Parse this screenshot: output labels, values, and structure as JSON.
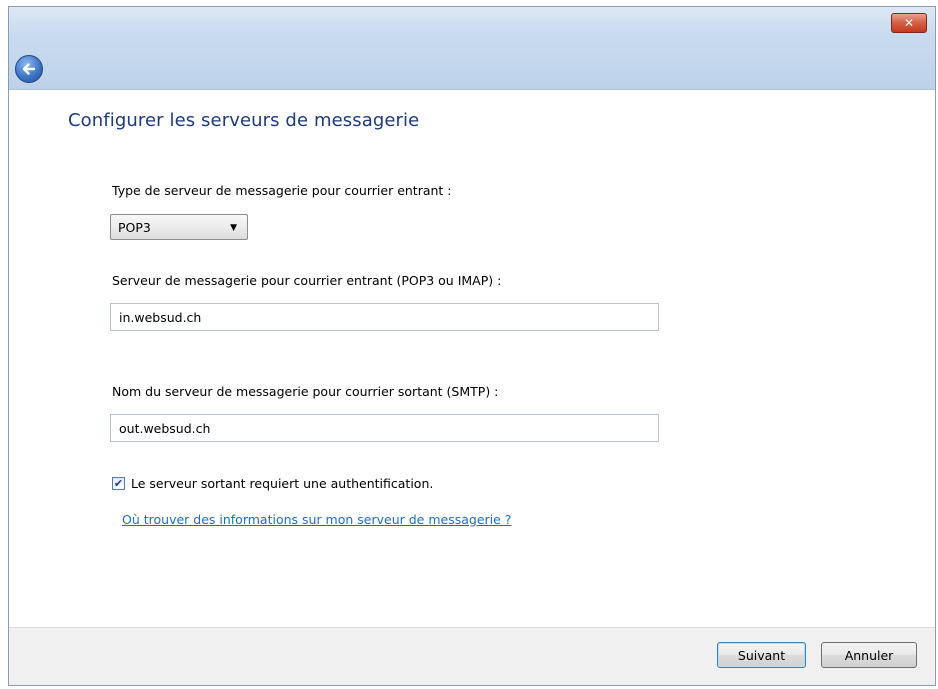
{
  "window": {
    "close_glyph": "✕",
    "back_glyph": "←"
  },
  "page": {
    "title": "Configurer les serveurs de messagerie"
  },
  "incoming_type": {
    "label": "Type de serveur de messagerie pour courrier entrant :",
    "selected": "POP3",
    "arrow": "▼"
  },
  "incoming_server": {
    "label": "Serveur de messagerie pour courrier entrant (POP3 ou IMAP) :",
    "value": "in.websud.ch"
  },
  "outgoing_server": {
    "label": "Nom du serveur de messagerie pour courrier sortant (SMTP) :",
    "value": "out.websud.ch"
  },
  "auth_checkbox": {
    "checked": true,
    "check_glyph": "✔",
    "label": "Le serveur sortant requiert une authentification."
  },
  "help_link": "Où trouver des informations sur mon serveur de messagerie ?",
  "footer": {
    "next_label": "Suivant",
    "cancel_label": "Annuler"
  },
  "colors": {
    "title": "#1e3a7a",
    "link": "#1a6fc4",
    "close_button": "#c13a1f"
  }
}
